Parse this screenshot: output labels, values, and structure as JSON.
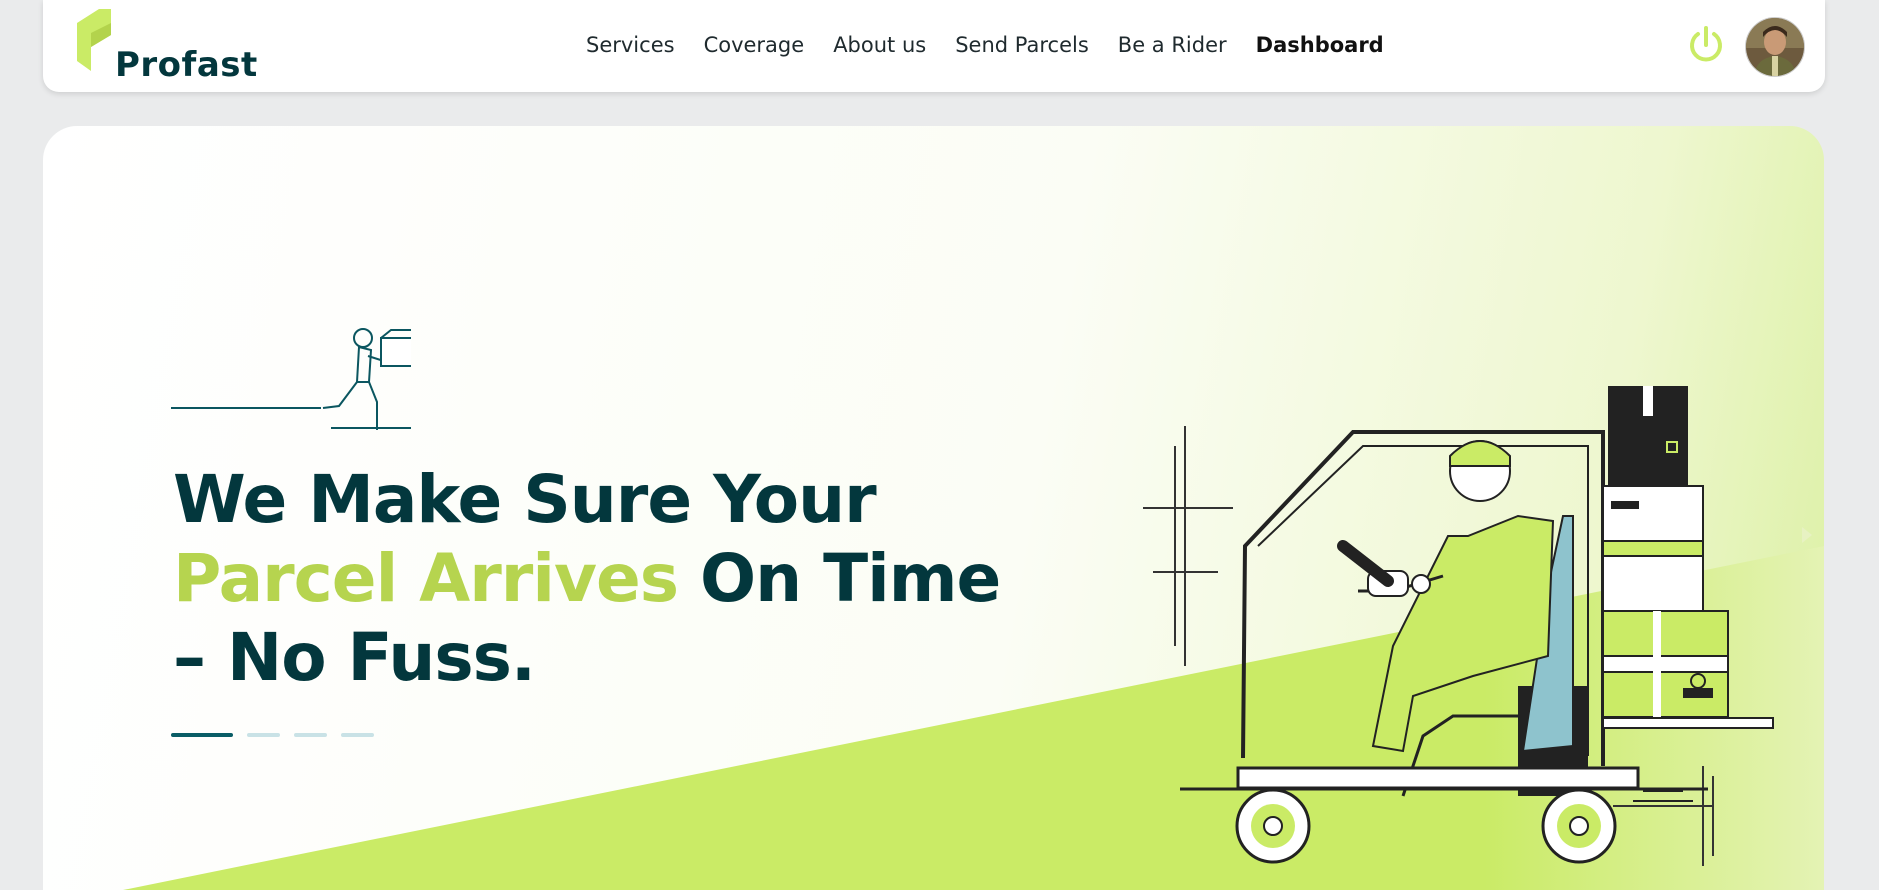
{
  "brand": {
    "name": "Profast",
    "accent_color": "#caeb66",
    "primary_color": "#03373d"
  },
  "nav": {
    "links": [
      {
        "label": "Services"
      },
      {
        "label": "Coverage"
      },
      {
        "label": "About us"
      },
      {
        "label": "Send Parcels"
      },
      {
        "label": "Be a Rider"
      },
      {
        "label": "Dashboard",
        "active": true
      }
    ],
    "icons": {
      "logout": "power-icon",
      "profile": "user-avatar"
    }
  },
  "hero": {
    "title_line1": "We Make Sure Your",
    "title_accent": "Parcel Arrives",
    "title_line2_rest": " On Time",
    "title_line3": "– No Fuss.",
    "slides_total": 4,
    "active_slide": 1,
    "next_icon": "chevron-right-icon"
  }
}
